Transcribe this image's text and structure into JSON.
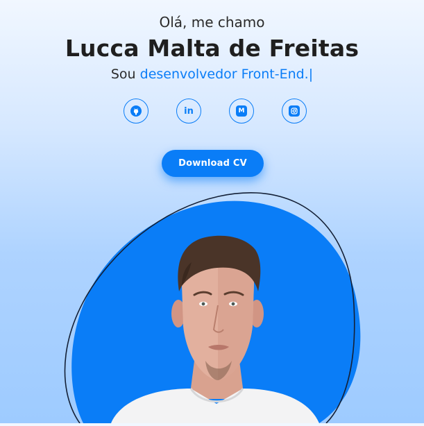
{
  "hero": {
    "greeting": "Olá, me chamo",
    "name": "Lucca Malta de Freitas",
    "role_prefix": "Sou",
    "role_typed": "desenvolvedor Front-End.",
    "cursor": "|"
  },
  "socials": [
    {
      "icon": "github-icon"
    },
    {
      "icon": "linkedin-icon",
      "glyph": "in"
    },
    {
      "icon": "medium-icon",
      "glyph": "M"
    },
    {
      "icon": "instagram-icon"
    }
  ],
  "cta": {
    "download_label": "Download CV"
  },
  "colors": {
    "accent": "#0a7df7",
    "text_dark": "#1f1f1f",
    "blob_outline": "#142036"
  }
}
